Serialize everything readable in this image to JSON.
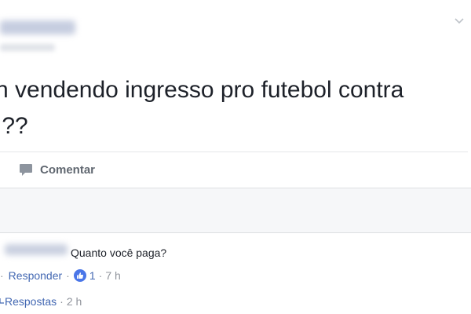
{
  "post": {
    "text_line1": "n vendendo ingresso pro futebol contra",
    "text_line2": "??",
    "comment_action": "Comentar"
  },
  "comment": {
    "text": "Quanto você paga?",
    "reply_label": "Responder",
    "separator": "·",
    "likes": "1",
    "time": "7 h"
  },
  "replies": {
    "label": "Respostas",
    "time": "2 h"
  },
  "colors": {
    "link": "#4267b2",
    "like_badge": "#4a76e8",
    "text": "#1d2129"
  }
}
